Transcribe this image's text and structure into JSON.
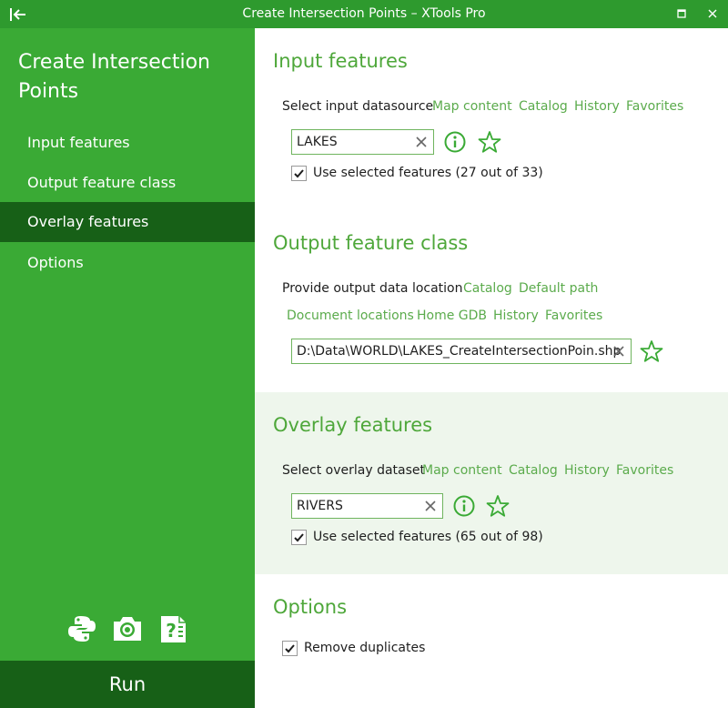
{
  "window": {
    "title": "Create Intersection Points – XTools Pro",
    "back_icon": "collapse-left-icon",
    "maximize_icon": "maximize-icon",
    "close_icon": "close-icon"
  },
  "sidebar": {
    "heading_line1": "Create Intersection",
    "heading_line2": "Points",
    "items": [
      {
        "label": "Input features",
        "active": false
      },
      {
        "label": "Output feature class",
        "active": false
      },
      {
        "label": "Overlay features",
        "active": true
      },
      {
        "label": "Options",
        "active": false
      }
    ],
    "tools": [
      "python-icon",
      "camera-icon",
      "help-icon"
    ],
    "run_label": "Run"
  },
  "input_features": {
    "title": "Input features",
    "label": "Select input datasource",
    "links": [
      "Map content",
      "Catalog",
      "History",
      "Favorites"
    ],
    "value": "LAKES",
    "use_selected_checked": true,
    "use_selected_label": "Use selected features (27 out of 33)"
  },
  "output_feature_class": {
    "title": "Output feature class",
    "label": "Provide output data location",
    "links_row1": [
      "Catalog",
      "Default path"
    ],
    "links_row2": [
      "Document locations",
      "Home GDB",
      "History",
      "Favorites"
    ],
    "value": "D:\\Data\\WORLD\\LAKES_CreateIntersectionPoin.shp"
  },
  "overlay_features": {
    "title": "Overlay features",
    "label": "Select overlay dataset",
    "links": [
      "Map content",
      "Catalog",
      "History",
      "Favorites"
    ],
    "value": "RIVERS",
    "use_selected_checked": true,
    "use_selected_label": "Use selected features (65 out of 98)"
  },
  "options": {
    "title": "Options",
    "remove_duplicates_checked": true,
    "remove_duplicates_label": "Remove duplicates"
  },
  "colors": {
    "sidebar": "#3aaa35",
    "sidebar_active": "#176017",
    "titlebar": "#2e9a2e",
    "accent_text": "#4ea73a",
    "link": "#5bab4c",
    "shaded_section": "#eef6ec"
  }
}
